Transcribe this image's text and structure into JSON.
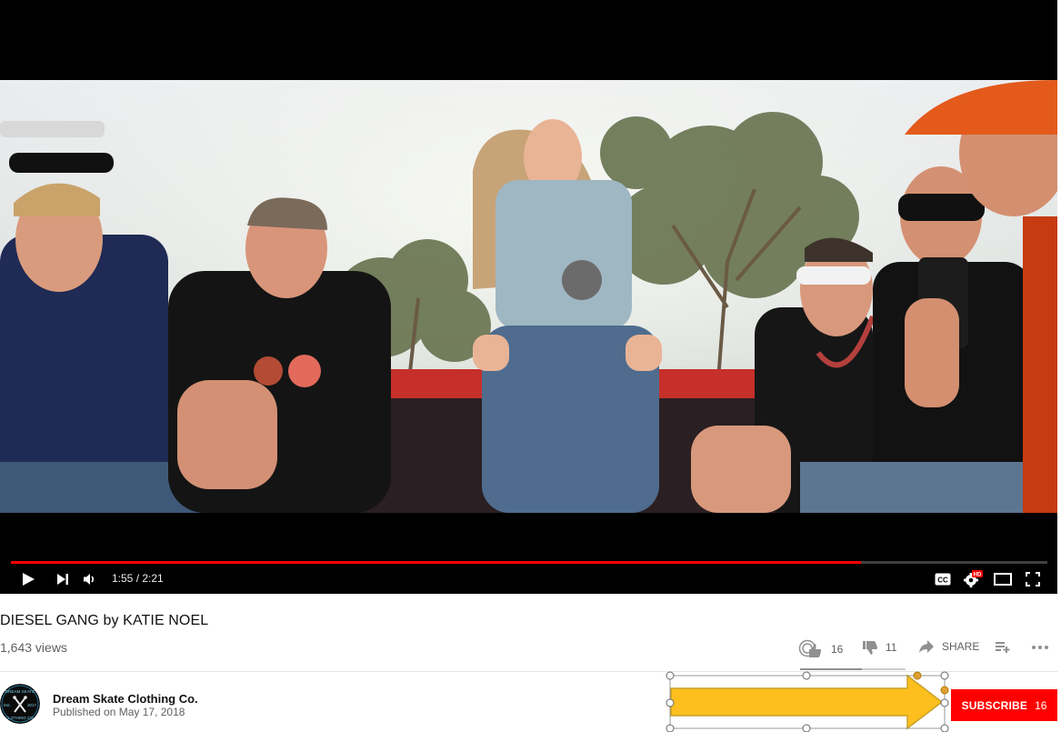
{
  "player": {
    "time_display": "1:55 / 2:21",
    "progress_fraction": 0.82,
    "controls": {
      "play": "play-icon",
      "next": "next-icon",
      "volume": "volume-icon",
      "captions": "cc-icon",
      "settings": "gear-hd-icon",
      "theater": "theater-mode-icon",
      "fullscreen": "fullscreen-icon"
    },
    "captions_label": "CC",
    "hd_badge": "HD",
    "progress_color": "#ff0000"
  },
  "video": {
    "title": "DIESEL GANG by KATIE NOEL",
    "views": "1,643 views",
    "like_count": "16",
    "dislike_count": "11",
    "like_fraction": 0.59,
    "share_label": "SHARE"
  },
  "channel": {
    "name": "Dream Skate Clothing Co.",
    "published": "Published on May 17, 2018",
    "avatar_text": {
      "top": "DREAM SKATE",
      "left": "Est.",
      "right": "2017",
      "bottom": "CLOTHING CO."
    },
    "subscribe_label": "SUBSCRIBE",
    "subscriber_count": "16"
  },
  "annotation": {
    "shape": "right-arrow",
    "fill_color": "#fcbf1e",
    "stroke_color": "#c9a227"
  },
  "colors": {
    "brand_red": "#ff0000",
    "text_primary": "#111111",
    "text_secondary": "#606060"
  }
}
